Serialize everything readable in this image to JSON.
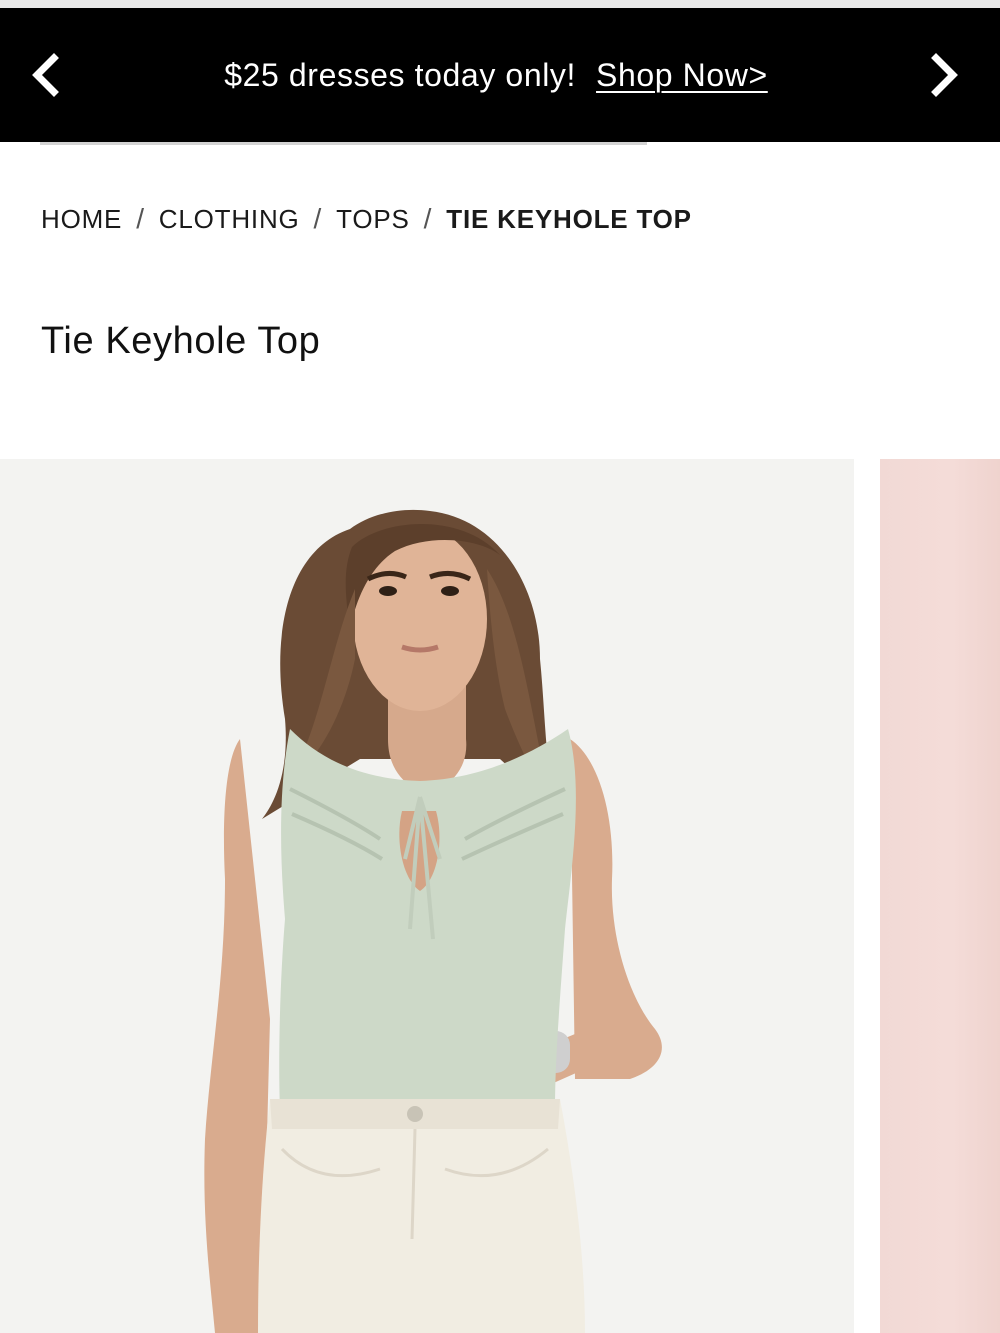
{
  "promo": {
    "message": "$25 dresses today only!",
    "link_label": "Shop Now>",
    "prev_icon": "chevron-left-icon",
    "next_icon": "chevron-right-icon",
    "background_color": "#000000",
    "text_color": "#ffffff"
  },
  "breadcrumb": {
    "items": [
      {
        "label": "HOME"
      },
      {
        "label": "CLOTHING"
      },
      {
        "label": "TOPS"
      },
      {
        "label": "TIE KEYHOLE TOP"
      }
    ],
    "separator": "/"
  },
  "product": {
    "title": "Tie Keyhole Top",
    "top_color": "#cdd9c8",
    "pants_color": "#f1ede2"
  },
  "gallery": {
    "next_slide_color": "#f2d9d5"
  }
}
